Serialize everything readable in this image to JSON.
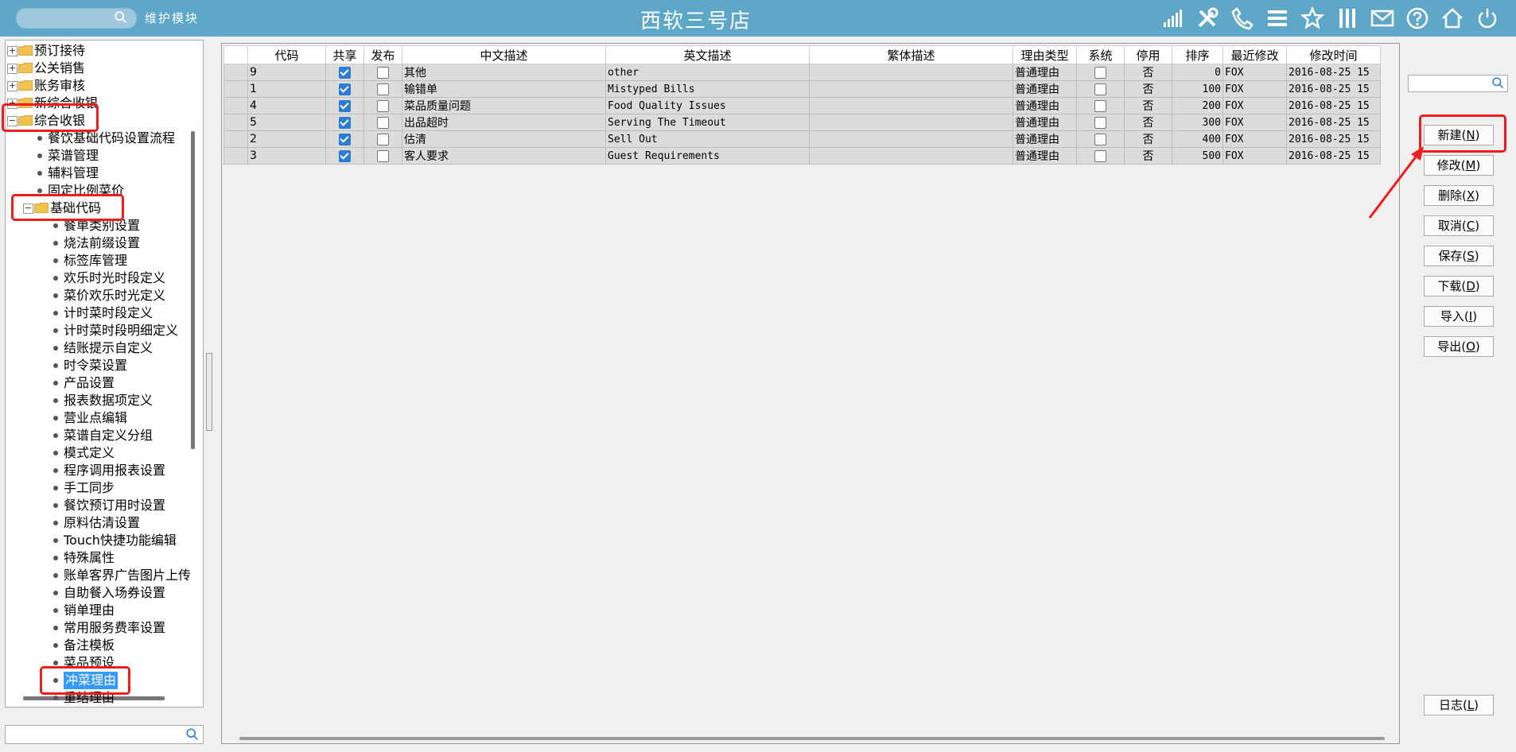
{
  "titlebar": {
    "module_label": "维护模块",
    "title": "西软三号店",
    "icons": [
      "signal-icon",
      "tools-icon",
      "phone-icon",
      "menu-icon",
      "star-icon",
      "columns-icon",
      "mail-icon",
      "help-icon",
      "home-icon",
      "power-icon"
    ]
  },
  "tree": {
    "items": [
      {
        "label": "预订接待",
        "level": 0,
        "toggle": "+"
      },
      {
        "label": "公关销售",
        "level": 0,
        "toggle": "+"
      },
      {
        "label": "账务审核",
        "level": 0,
        "toggle": "+"
      },
      {
        "label": "新综合收银",
        "level": 0,
        "toggle": "+"
      },
      {
        "label": "综合收银",
        "level": 0,
        "toggle": "-"
      },
      {
        "label": "餐饮基础代码设置流程",
        "level": 1
      },
      {
        "label": "菜谱管理",
        "level": 1
      },
      {
        "label": "辅料管理",
        "level": 1
      },
      {
        "label": "固定比例菜价",
        "level": 1
      },
      {
        "label": "基础代码",
        "level": 1,
        "toggle": "-"
      },
      {
        "label": "餐单类别设置",
        "level": 2
      },
      {
        "label": "烧法前缀设置",
        "level": 2
      },
      {
        "label": "标签库管理",
        "level": 2
      },
      {
        "label": "欢乐时光时段定义",
        "level": 2
      },
      {
        "label": "菜价欢乐时光定义",
        "level": 2
      },
      {
        "label": "计时菜时段定义",
        "level": 2
      },
      {
        "label": "计时菜时段明细定义",
        "level": 2
      },
      {
        "label": "结账提示自定义",
        "level": 2
      },
      {
        "label": "时令菜设置",
        "level": 2
      },
      {
        "label": "产品设置",
        "level": 2
      },
      {
        "label": "报表数据项定义",
        "level": 2
      },
      {
        "label": "营业点编辑",
        "level": 2
      },
      {
        "label": "菜谱自定义分组",
        "level": 2
      },
      {
        "label": "模式定义",
        "level": 2
      },
      {
        "label": "程序调用报表设置",
        "level": 2
      },
      {
        "label": "手工同步",
        "level": 2
      },
      {
        "label": "餐饮预订用时设置",
        "level": 2
      },
      {
        "label": "原料估清设置",
        "level": 2
      },
      {
        "label": "Touch快捷功能编辑",
        "level": 2
      },
      {
        "label": "特殊属性",
        "level": 2
      },
      {
        "label": "账单客界广告图片上传",
        "level": 2
      },
      {
        "label": "自助餐入场券设置",
        "level": 2
      },
      {
        "label": "销单理由",
        "level": 2
      },
      {
        "label": "常用服务费率设置",
        "level": 2
      },
      {
        "label": "备注模板",
        "level": 2
      },
      {
        "label": "菜品预设",
        "level": 2
      },
      {
        "label": "冲菜理由",
        "level": 2,
        "selected": true
      },
      {
        "label": "重结理由",
        "level": 2
      }
    ]
  },
  "grid": {
    "columns": [
      "",
      "代码",
      "共享",
      "发布",
      "中文描述",
      "英文描述",
      "繁体描述",
      "理由类型",
      "系统",
      "停用",
      "排序",
      "最近修改",
      "修改时间"
    ],
    "rows": [
      {
        "code": "9",
        "shared": true,
        "publish": false,
        "cn": "其他",
        "en": "other",
        "tw": "",
        "type": "普通理由",
        "system": false,
        "disabled": "否",
        "order": "0",
        "modifier": "FOX",
        "time": "2016-08-25 15"
      },
      {
        "code": "1",
        "shared": true,
        "publish": false,
        "cn": "输错单",
        "en": "Mistyped Bills",
        "tw": "",
        "type": "普通理由",
        "system": false,
        "disabled": "否",
        "order": "100",
        "modifier": "FOX",
        "time": "2016-08-25 15"
      },
      {
        "code": "4",
        "shared": true,
        "publish": false,
        "cn": "菜品质量问题",
        "en": "Food Quality Issues",
        "tw": "",
        "type": "普通理由",
        "system": false,
        "disabled": "否",
        "order": "200",
        "modifier": "FOX",
        "time": "2016-08-25 15"
      },
      {
        "code": "5",
        "shared": true,
        "publish": false,
        "cn": "出品超时",
        "en": "Serving The Timeout",
        "tw": "",
        "type": "普通理由",
        "system": false,
        "disabled": "否",
        "order": "300",
        "modifier": "FOX",
        "time": "2016-08-25 15"
      },
      {
        "code": "2",
        "shared": true,
        "publish": false,
        "cn": "估清",
        "en": "Sell Out",
        "tw": "",
        "type": "普通理由",
        "system": false,
        "disabled": "否",
        "order": "400",
        "modifier": "FOX",
        "time": "2016-08-25 15"
      },
      {
        "code": "3",
        "shared": true,
        "publish": false,
        "cn": "客人要求",
        "en": "Guest Requirements",
        "tw": "",
        "type": "普通理由",
        "system": false,
        "disabled": "否",
        "order": "500",
        "modifier": "FOX",
        "time": "2016-08-25 15"
      }
    ]
  },
  "buttons": {
    "new": {
      "label": "新建(",
      "key": "N",
      "end": ")"
    },
    "modify": {
      "label": "修改(",
      "key": "M",
      "end": ")"
    },
    "delete": {
      "label": "删除(",
      "key": "X",
      "end": ")"
    },
    "cancel": {
      "label": "取消(",
      "key": "C",
      "end": ")"
    },
    "save": {
      "label": "保存(",
      "key": "S",
      "end": ")"
    },
    "download": {
      "label": "下载(",
      "key": "D",
      "end": ")"
    },
    "import": {
      "label": "导入(",
      "key": "I",
      "end": ")"
    },
    "export": {
      "label": "导出(",
      "key": "O",
      "end": ")"
    },
    "log": {
      "label": "日志(",
      "key": "L",
      "end": ")"
    }
  },
  "colors": {
    "titlebar": "#5fa7c9",
    "highlight": "#ee1c1c",
    "selected": "#3399ff",
    "checkbox": "#2c7cd6"
  }
}
